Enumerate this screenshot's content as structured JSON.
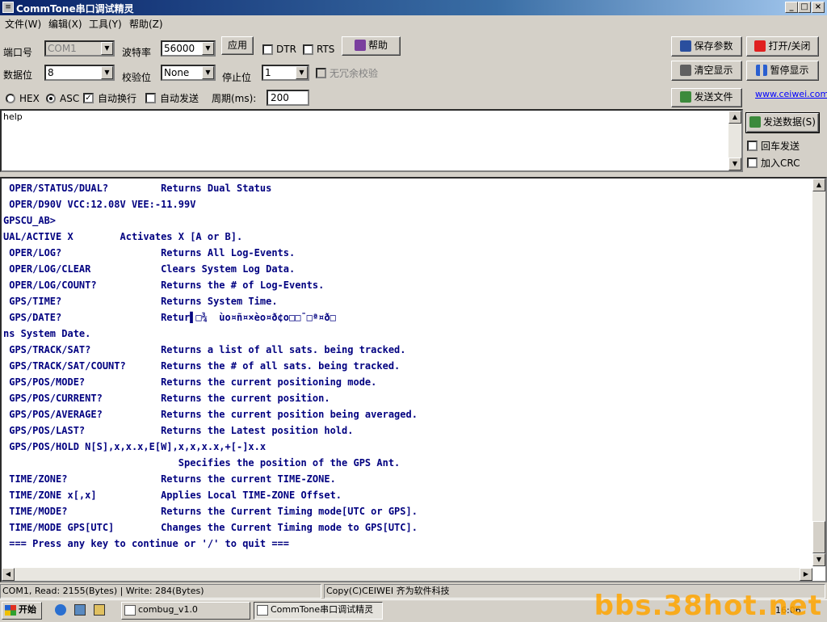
{
  "window": {
    "title": "CommTone串口调试精灵",
    "controls": [
      "_",
      "□",
      "×"
    ]
  },
  "menu": [
    "文件(W)",
    "编辑(X)",
    "工具(Y)",
    "帮助(Z)"
  ],
  "settings": {
    "port_label": "端口号",
    "port_value": "COM1",
    "baud_label": "波特率",
    "baud_value": "56000",
    "apply_label": "应用",
    "dtr_label": "DTR",
    "rts_label": "RTS",
    "help_label": "帮助",
    "databits_label": "数据位",
    "databits_value": "8",
    "parity_label": "校验位",
    "parity_value": "None",
    "stopbits_label": "停止位",
    "stopbits_value": "1",
    "no_redundant_label": "无冗余校验"
  },
  "right_buttons": {
    "save_params": "保存参数",
    "open_close": "打开/关闭",
    "clear_display": "清空显示",
    "pause_display": "暂停显示",
    "send_file": "发送文件",
    "website": "www.ceiwei.com"
  },
  "send_options": {
    "hex_label": "HEX",
    "asc_label": "ASC",
    "asc_selected": true,
    "auto_wrap_label": "自动换行",
    "auto_wrap_checked": true,
    "auto_send_label": "自动发送",
    "period_label": "周期(ms):",
    "period_value": "200"
  },
  "send_box": {
    "text": "help",
    "send_button": "发送数据(S)",
    "cr_send_label": "回车发送",
    "add_crc_label": "加入CRC"
  },
  "receive_lines": [
    " OPER/STATUS/DUAL?         Returns Dual Status",
    " OPER/D90V VCC:12.08V VEE:-11.99V",
    "GPSCU_AB>",
    "UAL/ACTIVE X        Activates X [A or B].",
    " OPER/LOG?                 Returns All Log-Events.",
    " OPER/LOG/CLEAR            Clears System Log Data.",
    " OPER/LOG/COUNT?           Returns the # of Log-Events.",
    " GPS/TIME?                 Returns System Time.",
    " GPS/DATE?                 Retur▌□¾  ùo¤ñ¤×èo¤ð¢o□□¯□ª¤ð□",
    "ns System Date.",
    " GPS/TRACK/SAT?            Returns a list of all sats. being tracked.",
    " GPS/TRACK/SAT/COUNT?      Returns the # of all sats. being tracked.",
    " GPS/POS/MODE?             Returns the current positioning mode.",
    " GPS/POS/CURRENT?          Returns the current position.",
    " GPS/POS/AVERAGE?          Returns the current position being averaged.",
    " GPS/POS/LAST?             Returns the Latest position hold.",
    " GPS/POS/HOLD N[S],x,x.x,E[W],x,x,x.x,+[-]x.x",
    "                              Specifies the position of the GPS Ant.",
    " TIME/ZONE?                Returns the current TIME-ZONE.",
    " TIME/ZONE x[,x]           Applies Local TIME-ZONE Offset.",
    " TIME/MODE?                Returns the Current Timing mode[UTC or GPS].",
    " TIME/MODE GPS[UTC]        Changes the Current Timing mode to GPS[UTC].",
    " === Press any key to continue or '/' to quit ==="
  ],
  "status": {
    "left": "COM1, Read: 2155(Bytes) | Write: 284(Bytes)",
    "right": "Copy(C)CEIWEI 齐为软件科技"
  },
  "taskbar": {
    "start": "开始",
    "tasks": [
      "combug_v1.0",
      "CommTone串口调试精灵"
    ],
    "clock": "16:06"
  },
  "watermark": "bbs.38hot.net"
}
